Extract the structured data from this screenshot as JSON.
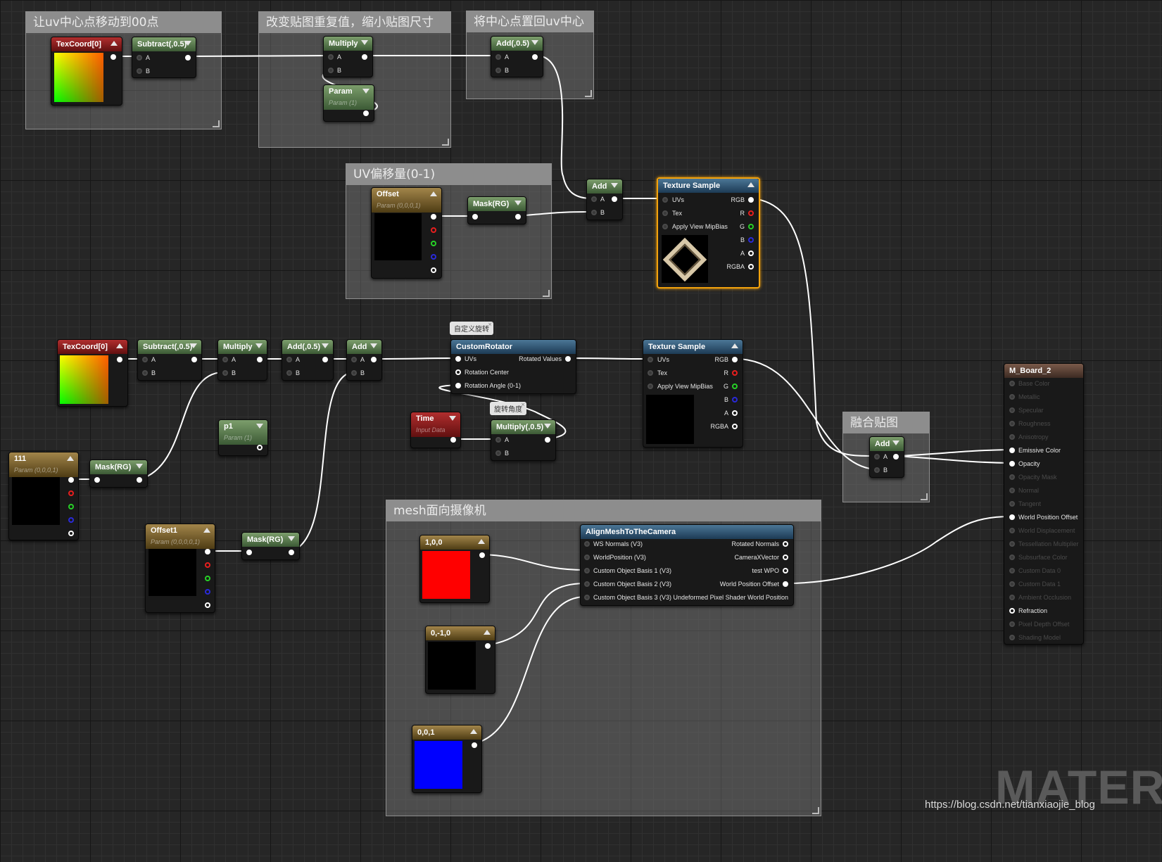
{
  "comments": {
    "c1": "让uv中心点移动到00点",
    "c2": "改变贴图重复值，缩小贴图尺寸",
    "c3": "将中心点置回uv中心",
    "c4": "UV偏移量(0-1)",
    "c5": "融合贴图",
    "c6": "mesh面向摄像机"
  },
  "nodes": {
    "texcoord_top": {
      "title": "TexCoord[0]"
    },
    "subtract_top": {
      "title": "Subtract(,0.5)",
      "a": "A",
      "b": "B"
    },
    "multiply_top": {
      "title": "Multiply",
      "a": "A",
      "b": "B"
    },
    "param": {
      "title": "Param",
      "sub": "Param (1)"
    },
    "add05_top": {
      "title": "Add(,0.5)",
      "a": "A",
      "b": "B"
    },
    "offset": {
      "title": "Offset",
      "sub": "Param (0,0,0,1)"
    },
    "maskrg_top": {
      "title": "Mask(RG)"
    },
    "add_top": {
      "title": "Add",
      "a": "A",
      "b": "B"
    },
    "texsample_top": {
      "title": "Texture Sample",
      "uvs": "UVs",
      "tex": "Tex",
      "mip": "Apply View MipBias",
      "rgb": "RGB",
      "r": "R",
      "g": "G",
      "bb": "B",
      "a": "A",
      "rgba": "RGBA"
    },
    "texcoord_mid": {
      "title": "TexCoord[0]"
    },
    "subtract_mid": {
      "title": "Subtract(,0.5)",
      "a": "A",
      "b": "B"
    },
    "multiply_mid": {
      "title": "Multiply",
      "a": "A",
      "b": "B"
    },
    "add05_mid": {
      "title": "Add(,0.5)",
      "a": "A",
      "b": "B"
    },
    "add_mid": {
      "title": "Add",
      "a": "A",
      "b": "B"
    },
    "customrotator": {
      "title": "CustomRotator",
      "uvs": "UVs",
      "center": "Rotation Center",
      "angle": "Rotation Angle (0-1)",
      "out": "Rotated Values"
    },
    "texsample_mid": {
      "title": "Texture Sample",
      "uvs": "UVs",
      "tex": "Tex",
      "mip": "Apply View MipBias",
      "rgb": "RGB",
      "r": "R",
      "g": "G",
      "bb": "B",
      "a": "A",
      "rgba": "RGBA"
    },
    "p1": {
      "title": "p1",
      "sub": "Param (1)"
    },
    "param111": {
      "title": "111",
      "sub": "Param (0,0,0,1)"
    },
    "maskrg_mid": {
      "title": "Mask(RG)"
    },
    "time": {
      "title": "Time",
      "sub": "Input Data"
    },
    "multiply05": {
      "title": "Multiply(,0.5)",
      "a": "A",
      "b": "B"
    },
    "offset1": {
      "title": "Offset1",
      "sub": "Param (0,0,0,0,1)"
    },
    "maskrg_low": {
      "title": "Mask(RG)"
    },
    "add_blend": {
      "title": "Add",
      "a": "A",
      "b": "B"
    },
    "v100": {
      "title": "1,0,0"
    },
    "v0m10": {
      "title": "0,-1,0"
    },
    "v001": {
      "title": "0,0,1"
    },
    "align": {
      "title": "AlignMeshToTheCamera",
      "in1": "WS Normals (V3)",
      "in2": "WorldPosition (V3)",
      "in3": "Custom Object Basis 1 (V3)",
      "in4": "Custom Object Basis 2 (V3)",
      "in5": "Custom Object Basis 3 (V3) Undeformed Pixel Shader World Position",
      "out1": "Rotated Normals",
      "out2": "CameraXVector",
      "out3": "test WPO",
      "out4": "World Position Offset"
    }
  },
  "bubbles": {
    "rotator": "自定义旋转",
    "angle": "旋转角度"
  },
  "material": {
    "title": "M_Board_2",
    "pins": [
      "Base Color",
      "Metallic",
      "Specular",
      "Roughness",
      "Anisotropy",
      "Emissive Color",
      "Opacity",
      "Opacity Mask",
      "Normal",
      "Tangent",
      "World Position Offset",
      "World Displacement",
      "Tessellation Multiplier",
      "Subsurface Color",
      "Custom Data 0",
      "Custom Data 1",
      "Ambient Occlusion",
      "Refraction",
      "Pixel Depth Offset",
      "Shading Model"
    ],
    "active": [
      "Emissive Color",
      "Opacity",
      "World Position Offset",
      "Refraction"
    ]
  },
  "watermark": "MATER",
  "credit": "https://blog.csdn.net/tianxiaojie_blog",
  "colors": {
    "selection": "#f3a20c",
    "grid": "#262626",
    "wire": "#ffffff"
  }
}
